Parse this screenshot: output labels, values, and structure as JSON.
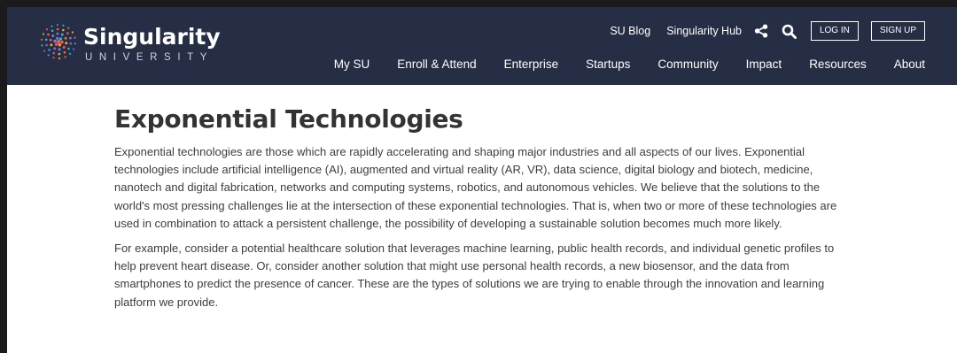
{
  "header": {
    "logo": {
      "wordmark": "Singularity",
      "subtitle": "UNIVERSITY"
    },
    "utility_links": [
      "SU Blog",
      "Singularity Hub"
    ],
    "utility_icons": [
      "share-icon",
      "search-icon"
    ],
    "login_label": "LOG IN",
    "signup_label": "SIGN UP",
    "nav": [
      "My SU",
      "Enroll & Attend",
      "Enterprise",
      "Startups",
      "Community",
      "Impact",
      "Resources",
      "About"
    ]
  },
  "main": {
    "title": "Exponential Technologies",
    "paragraphs": [
      "Exponential technologies are those which are rapidly accelerating and shaping major industries and all aspects of our lives. Exponential technologies include artificial intelligence (AI), augmented and virtual reality (AR, VR), data science, digital biology and biotech, medicine, nanotech and digital fabrication, networks and computing systems, robotics, and autonomous vehicles. We believe that the solutions to the world's most pressing challenges lie at the intersection of these exponential technologies. That is, when two or more of these technologies are used in combination to attack a persistent challenge, the possibility of developing a sustainable solution becomes much more likely.",
      "For example, consider a potential healthcare solution that leverages machine learning, public health records, and individual genetic profiles to help prevent heart disease. Or, consider another solution that might use personal health records, a new biosensor, and the data from smartphones to predict the presence of cancer. These are the types of solutions we are trying to enable through the innovation and learning platform we provide."
    ]
  },
  "colors": {
    "header_bg": "#252e44",
    "text": "#3d3d3d",
    "title": "#333333"
  }
}
